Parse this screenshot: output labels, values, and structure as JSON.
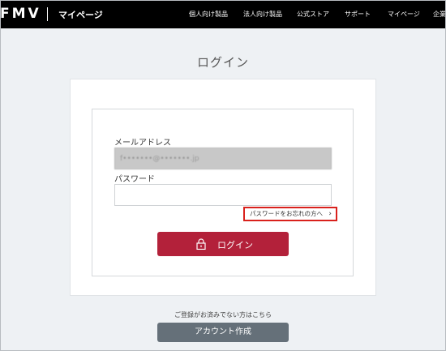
{
  "header": {
    "logo": "FMV",
    "subtitle": "マイページ",
    "nav": [
      "個人向け製品",
      "法人向け製品",
      "公式ストア",
      "サポート",
      "マイページ",
      "企業"
    ]
  },
  "login": {
    "title": "ログイン",
    "email_label": "メールアドレス",
    "email_value": "f•••••••@•••••••.jp",
    "password_label": "パスワード",
    "password_value": "",
    "forgot_link": "パスワードをお忘れの方へ",
    "login_button": "ログイン"
  },
  "signup": {
    "prompt": "ご登録がお済みでない方はこちら",
    "button": "アカウント作成"
  },
  "colors": {
    "header_bg": "#000000",
    "login_button": "#b3213a",
    "create_button": "#657079",
    "highlight_border": "#d9211c"
  }
}
